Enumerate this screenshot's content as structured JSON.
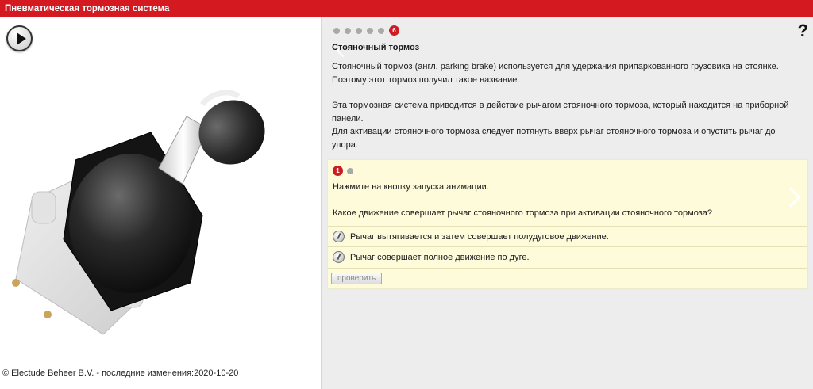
{
  "app": {
    "title": "Пневматическая тормозная система"
  },
  "footer": {
    "copyright": "© Electude Beheer B.V. - последние изменения:2020-10-20"
  },
  "stepper": {
    "active_step": "6"
  },
  "help": {
    "label": "?"
  },
  "content": {
    "title": "Стояночный тормоз",
    "paragraph1": "Стояночный тормоз (англ. parking brake) используется для удержания припаркованного грузовика на стоянке. Поэтому этот тормоз получил такое название.",
    "paragraph2": "Эта тормозная система приводится в действие рычагом стояночного тормоза, который находится на приборной панели.",
    "paragraph3": "Для активации стояночного тормоза следует потянуть вверх рычаг стояночного тормоза и опустить рычаг до упора."
  },
  "task": {
    "active_step": "1",
    "instruction": "Нажмите на кнопку запуска анимации.",
    "question": "Какое движение совершает рычаг стояночного тормоза при активации стояночного тормоза?",
    "options": [
      {
        "label": "Рычаг вытягивается и затем совершает полудуговое движение."
      },
      {
        "label": "Рычаг совершает полное движение по дуге."
      }
    ],
    "check_label": "проверить"
  }
}
